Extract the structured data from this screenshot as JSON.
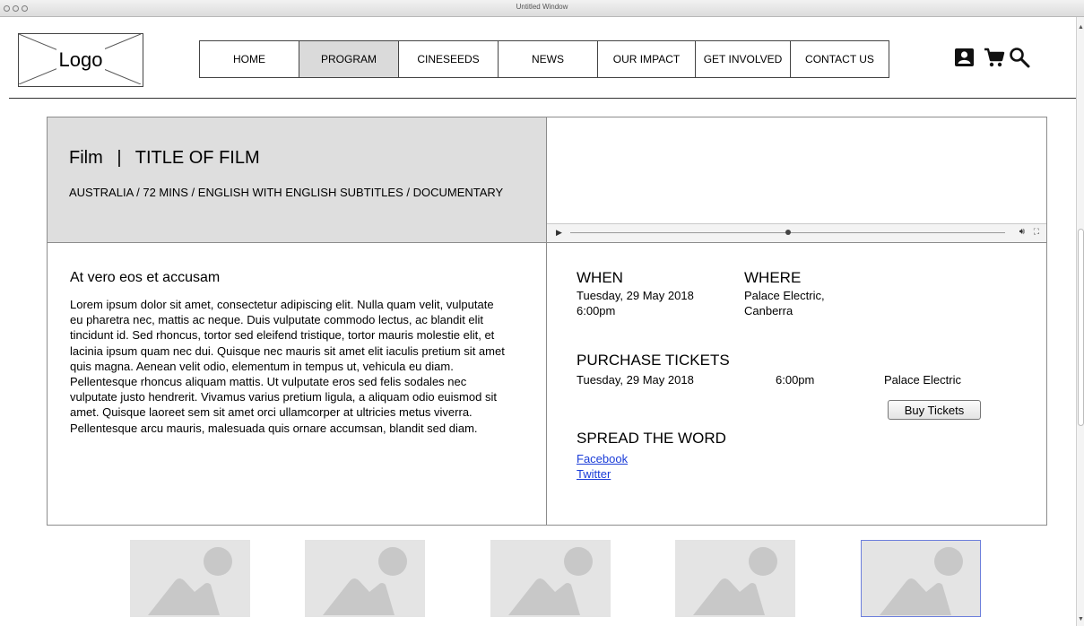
{
  "window": {
    "title": "Untitled Window"
  },
  "header": {
    "logo": "Logo",
    "nav": [
      {
        "label": "HOME",
        "active": false
      },
      {
        "label": "PROGRAM",
        "active": true
      },
      {
        "label": "CINESEEDS",
        "active": false
      },
      {
        "label": "NEWS",
        "active": false
      },
      {
        "label": "OUR IMPACT",
        "active": false
      },
      {
        "label": "GET INVOLVED",
        "active": false
      },
      {
        "label": "CONTACT US",
        "active": false
      }
    ],
    "icons": [
      "account-icon",
      "cart-icon",
      "search-icon"
    ]
  },
  "film": {
    "type": "Film",
    "separator": "|",
    "title": "TITLE OF FILM",
    "meta": "AUSTRALIA / 72 MINS / ENGLISH WITH ENGLISH SUBTITLES / DOCUMENTARY"
  },
  "video": {
    "progress": 0.5
  },
  "description": {
    "heading": "At vero eos et accusam",
    "body": "Lorem ipsum dolor sit amet, consectetur adipiscing elit. Nulla quam velit, vulputate eu pharetra nec, mattis ac neque. Duis vulputate commodo lectus, ac blandit elit tincidunt id. Sed rhoncus, tortor sed eleifend tristique, tortor mauris molestie elit, et lacinia ipsum quam nec dui. Quisque nec mauris sit amet elit iaculis pretium sit amet quis magna. Aenean velit odio, elementum in tempus ut, vehicula eu diam. Pellentesque rhoncus aliquam mattis. Ut vulputate eros sed felis sodales nec vulputate justo hendrerit. Vivamus varius pretium ligula, a aliquam odio euismod sit amet. Quisque laoreet sem sit amet orci ullamcorper at ultricies metus viverra. Pellentesque arcu mauris, malesuada quis ornare accumsan, blandit sed diam."
  },
  "info": {
    "when_label": "WHEN",
    "when_date": "Tuesday, 29 May 2018",
    "when_time": "6:00pm",
    "where_label": "WHERE",
    "where_line1": "Palace Electric,",
    "where_line2": "Canberra",
    "tickets_label": "PURCHASE TICKETS",
    "ticket_date": "Tuesday, 29 May 2018",
    "ticket_time": "6:00pm",
    "ticket_venue": "Palace Electric",
    "buy_label": "Buy Tickets",
    "spread_label": "SPREAD THE WORD",
    "links": [
      "Facebook",
      "Twitter"
    ]
  },
  "thumbnails": {
    "count": 5,
    "selected_index": 4
  }
}
